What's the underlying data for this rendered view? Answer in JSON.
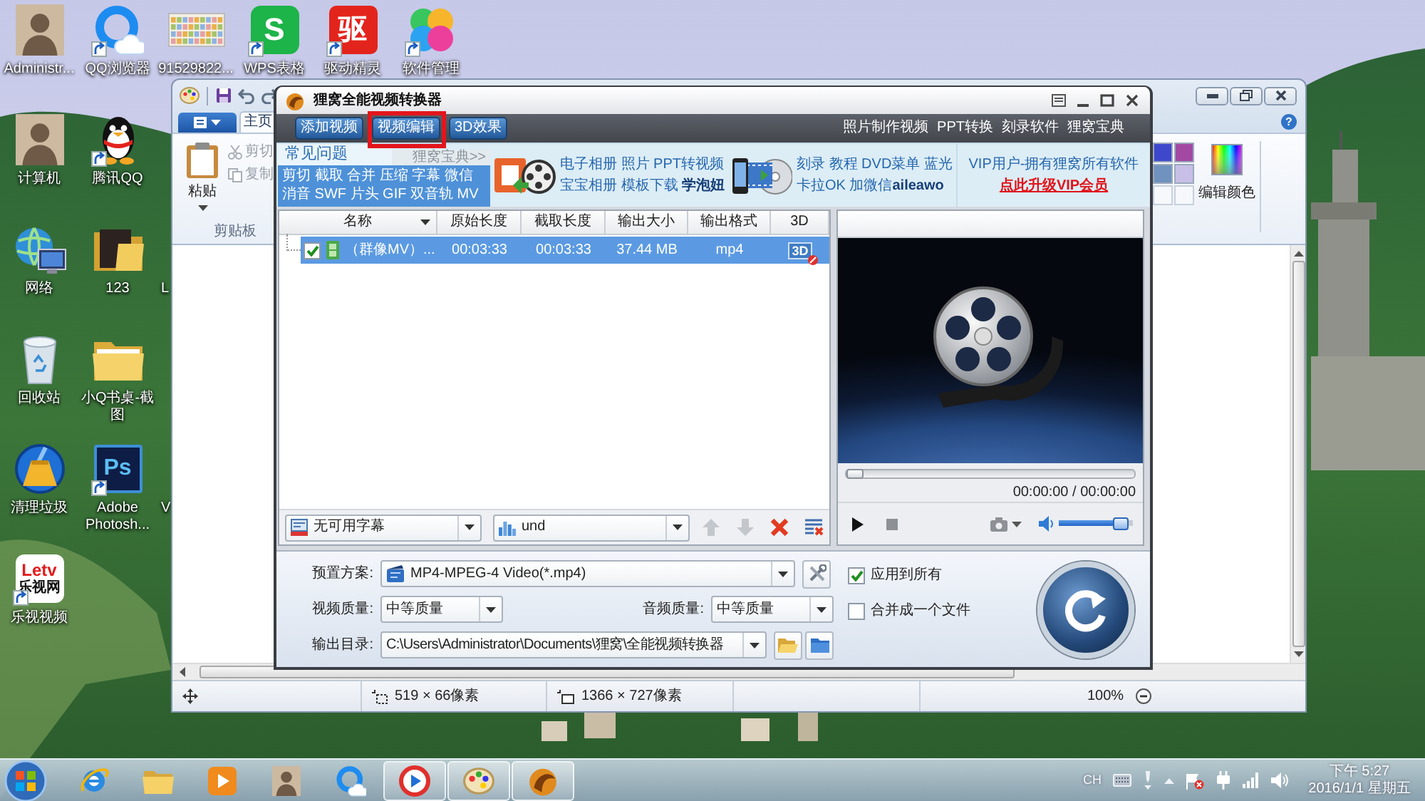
{
  "desktop": {
    "icons": [
      {
        "kind": "photo",
        "label": "Administr...",
        "shortcut": false
      },
      {
        "kind": "ring-browser",
        "label": "QQ浏览器",
        "shortcut": true
      },
      {
        "kind": "keyboard-image",
        "label": "91529822...",
        "shortcut": false
      },
      {
        "kind": "green-tile",
        "label": "WPS表格",
        "logo": "S",
        "shortcut": true
      },
      {
        "kind": "red-tile",
        "label": "驱动精灵",
        "logo": "驱",
        "shortcut": true
      },
      {
        "kind": "petals",
        "label": "软件管理",
        "shortcut": true
      },
      {
        "kind": "photo",
        "label": "计算机",
        "shortcut": false
      },
      {
        "kind": "penguin",
        "label": "腾讯QQ",
        "shortcut": true
      },
      {
        "kind": "network",
        "label": "网络",
        "shortcut": false
      },
      {
        "kind": "dark-folder",
        "label": "123",
        "shortcut": false
      },
      {
        "kind": "cut",
        "label": "L"
      },
      {
        "kind": "recycle-bin",
        "label": "回收站",
        "shortcut": false
      },
      {
        "kind": "folder",
        "label": "小Q书桌-截图",
        "shortcut": false
      },
      {
        "kind": "broom",
        "label": "清理垃圾",
        "shortcut": false
      },
      {
        "kind": "navy-tile",
        "label": "Adobe Photosh...",
        "logo": "Ps",
        "shortcut": true
      },
      {
        "kind": "cut",
        "label": "V"
      },
      {
        "kind": "letv",
        "label": "乐视视频",
        "logo": "Letv",
        "logo_sub": "乐视网",
        "shortcut": true
      }
    ]
  },
  "paint_window": {
    "tab": {
      "label": "主页",
      "selected": true
    },
    "help": "?",
    "clipboard": {
      "paste": "粘贴",
      "buttons": [
        {
          "kind": "cut",
          "label": "剪切",
          "disabled": true
        },
        {
          "kind": "copy",
          "label": "复制",
          "disabled": true
        }
      ],
      "group": "剪贴板"
    },
    "palette": [
      {
        "kind": "color",
        "color": "#3f48cc"
      },
      {
        "kind": "color",
        "color": "#a349a4"
      },
      {
        "kind": "color",
        "color": "#7092be"
      },
      {
        "kind": "color",
        "color": "#c8bfe7"
      },
      {
        "kind": "empty"
      },
      {
        "kind": "empty"
      }
    ],
    "edit_colors": "编辑颜色",
    "status": {
      "selection": "519 × 66像素",
      "canvas": "1366 × 727像素",
      "zoom": "100%"
    }
  },
  "converter": {
    "title": "狸窝全能视频转换器",
    "toolbar": [
      {
        "label": "添加视频",
        "highlighted": false
      },
      {
        "label": "视频编辑",
        "highlighted": true
      },
      {
        "label": "3D效果",
        "highlighted": false
      }
    ],
    "links": [
      "照片制作视频",
      "PPT转换",
      "刻录软件",
      "狸窝宝典"
    ],
    "faq": {
      "tab": "常见问题",
      "more": "狸窝宝典>>",
      "lines": [
        "剪切 截取 合并 压缩 字幕 微信",
        "消音 SWF 片头 GIF 双音轨 MV"
      ]
    },
    "promos": [
      {
        "kind": "slides",
        "lines": [
          "电子相册 照片 PPT转视频",
          "宝宝相册 模板下载 **学泡妞**"
        ]
      },
      {
        "kind": "disc",
        "lines": [
          "刻录 教程 DVD菜单 蓝光",
          "卡拉OK 加微信**aileawo**"
        ]
      }
    ],
    "vip": {
      "text": "VIP用户-拥有狸窝所有软件",
      "link": "点此升级VIP会员"
    },
    "file_list": {
      "columns": [
        "名称",
        "原始长度",
        "截取长度",
        "输出大小",
        "输出格式",
        "3D"
      ],
      "rows": [
        {
          "selected": true,
          "checked": true,
          "name": "（群像MV）...",
          "original": "00:03:33",
          "clipped": "00:03:33",
          "size": "37.44 MB",
          "format": "mp4",
          "badge_3d": "3D"
        }
      ],
      "subtitle": "无可用字幕",
      "audio_track": "und",
      "actions": [
        {
          "kind": "up",
          "disabled": true
        },
        {
          "kind": "down",
          "disabled": true
        },
        {
          "kind": "remove",
          "disabled": false
        },
        {
          "kind": "clear",
          "disabled": false
        }
      ]
    },
    "preview": {
      "seek": {
        "level": 0
      },
      "time": "00:00:00 / 00:00:00",
      "volume": {
        "level": 0.92
      }
    },
    "settings": {
      "preset": {
        "label": "预置方案:",
        "value": "MP4-MPEG-4 Video(*.mp4)"
      },
      "apply_all": {
        "label": "应用到所有",
        "checked": true
      },
      "video_quality": {
        "label": "视频质量:",
        "value": "中等质量"
      },
      "audio_quality": {
        "label": "音频质量:",
        "value": "中等质量"
      },
      "merge": {
        "label": "合并成一个文件",
        "checked": false
      },
      "output": {
        "label": "输出目录:",
        "value": "C:\\Users\\Administrator\\Documents\\狸窝\\全能视频转换器"
      }
    }
  },
  "taskbar": {
    "apps": [
      {
        "kind": "swirl-browser",
        "running": false
      },
      {
        "kind": "folder",
        "running": false
      },
      {
        "kind": "play-tile",
        "running": false
      },
      {
        "kind": "photo",
        "running": false
      },
      {
        "kind": "ring-browser",
        "running": false
      },
      {
        "kind": "play-circle",
        "running": true
      },
      {
        "kind": "palette",
        "running": true
      },
      {
        "kind": "converter",
        "running": true
      }
    ],
    "language": "CH",
    "time": "下午 5:27",
    "date": "2016/1/1 星期五"
  }
}
